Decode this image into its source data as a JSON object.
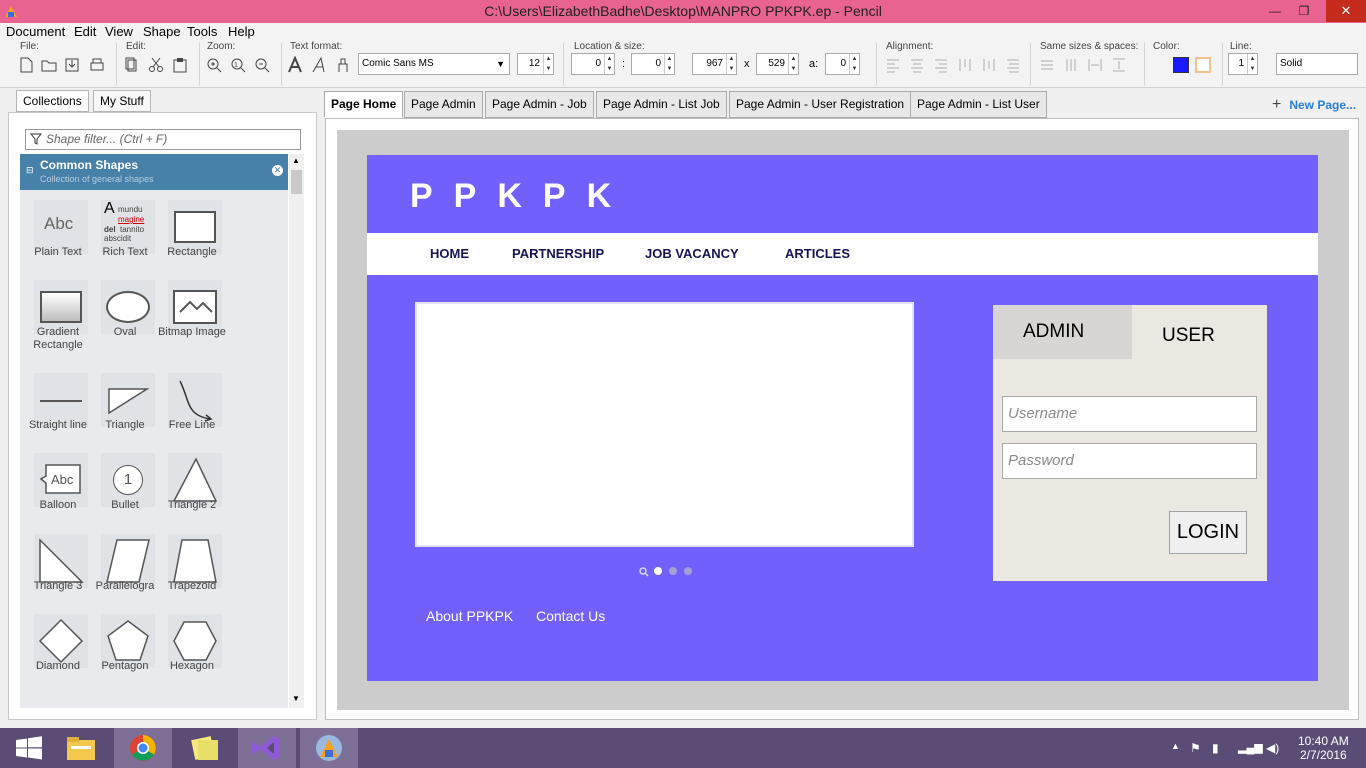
{
  "window": {
    "title": "C:\\Users\\ElizabethBadhe\\Desktop\\MANPRO PPKPK.ep - Pencil",
    "minimize": "—",
    "maximize": "❐",
    "close": "✕"
  },
  "menu": [
    "Document",
    "Edit",
    "View",
    "Shape",
    "Tools",
    "Help"
  ],
  "toolbar": {
    "file_label": "File:",
    "edit_label": "Edit:",
    "zoom_label": "Zoom:",
    "textformat_label": "Text format:",
    "font": "Comic Sans MS",
    "font_size": "12",
    "location_label": "Location & size:",
    "x": "0",
    "y": "0",
    "w": "967",
    "h": "529",
    "colon": ":",
    "times": "x",
    "angle_label": "a:",
    "angle": "0",
    "alignment_label": "Alignment:",
    "samesizes_label": "Same sizes & spaces:",
    "color_label": "Color:",
    "line_label": "Line:",
    "line_width": "1",
    "line_style": "Solid",
    "fill_color": "#1a1aff",
    "stroke_color": "#f4c28a"
  },
  "panel": {
    "tabs": [
      "Collections",
      "My Stuff"
    ],
    "filter_placeholder": "Shape filter... (Ctrl + F)",
    "collection_title": "Common Shapes",
    "collection_subtitle": "Collection of general shapes",
    "shapes": [
      "Plain Text",
      "Rich Text",
      "Rectangle",
      "Gradient Rectangle",
      "Oval",
      "Bitmap Image",
      "Straight line",
      "Triangle",
      "Free Line",
      "Balloon",
      "Bullet",
      "Triangle 2",
      "Triangle 3",
      "Parallelogra",
      "Trapezoid",
      "Diamond",
      "Pentagon",
      "Hexagon"
    ],
    "plain_text_glyph": "Abc",
    "rich_text_words": [
      "A",
      "mundu",
      "magine",
      "del",
      "tannito",
      "abscidit"
    ],
    "balloon_glyph": "Abc",
    "bullet_glyph": "1"
  },
  "doc_tabs": [
    "Page Home",
    "Page Admin",
    "Page Admin - Job",
    "Page Admin - List Job",
    "Page Admin - User Registration",
    "Page Admin - List User"
  ],
  "new_page": "New Page...",
  "mockup": {
    "brand": "PPKPK",
    "nav": [
      "HOME",
      "PARTNERSHIP",
      "JOB VACANCY",
      "ARTICLES"
    ],
    "login_tabs": [
      "ADMIN",
      "USER"
    ],
    "username_placeholder": "Username",
    "password_placeholder": "Password",
    "login_button": "LOGIN",
    "footer": [
      "About PPKPK",
      "Contact Us"
    ],
    "background_color": "#7160fb"
  },
  "taskbar": {
    "time": "10:40 AM",
    "date": "2/7/2016"
  }
}
